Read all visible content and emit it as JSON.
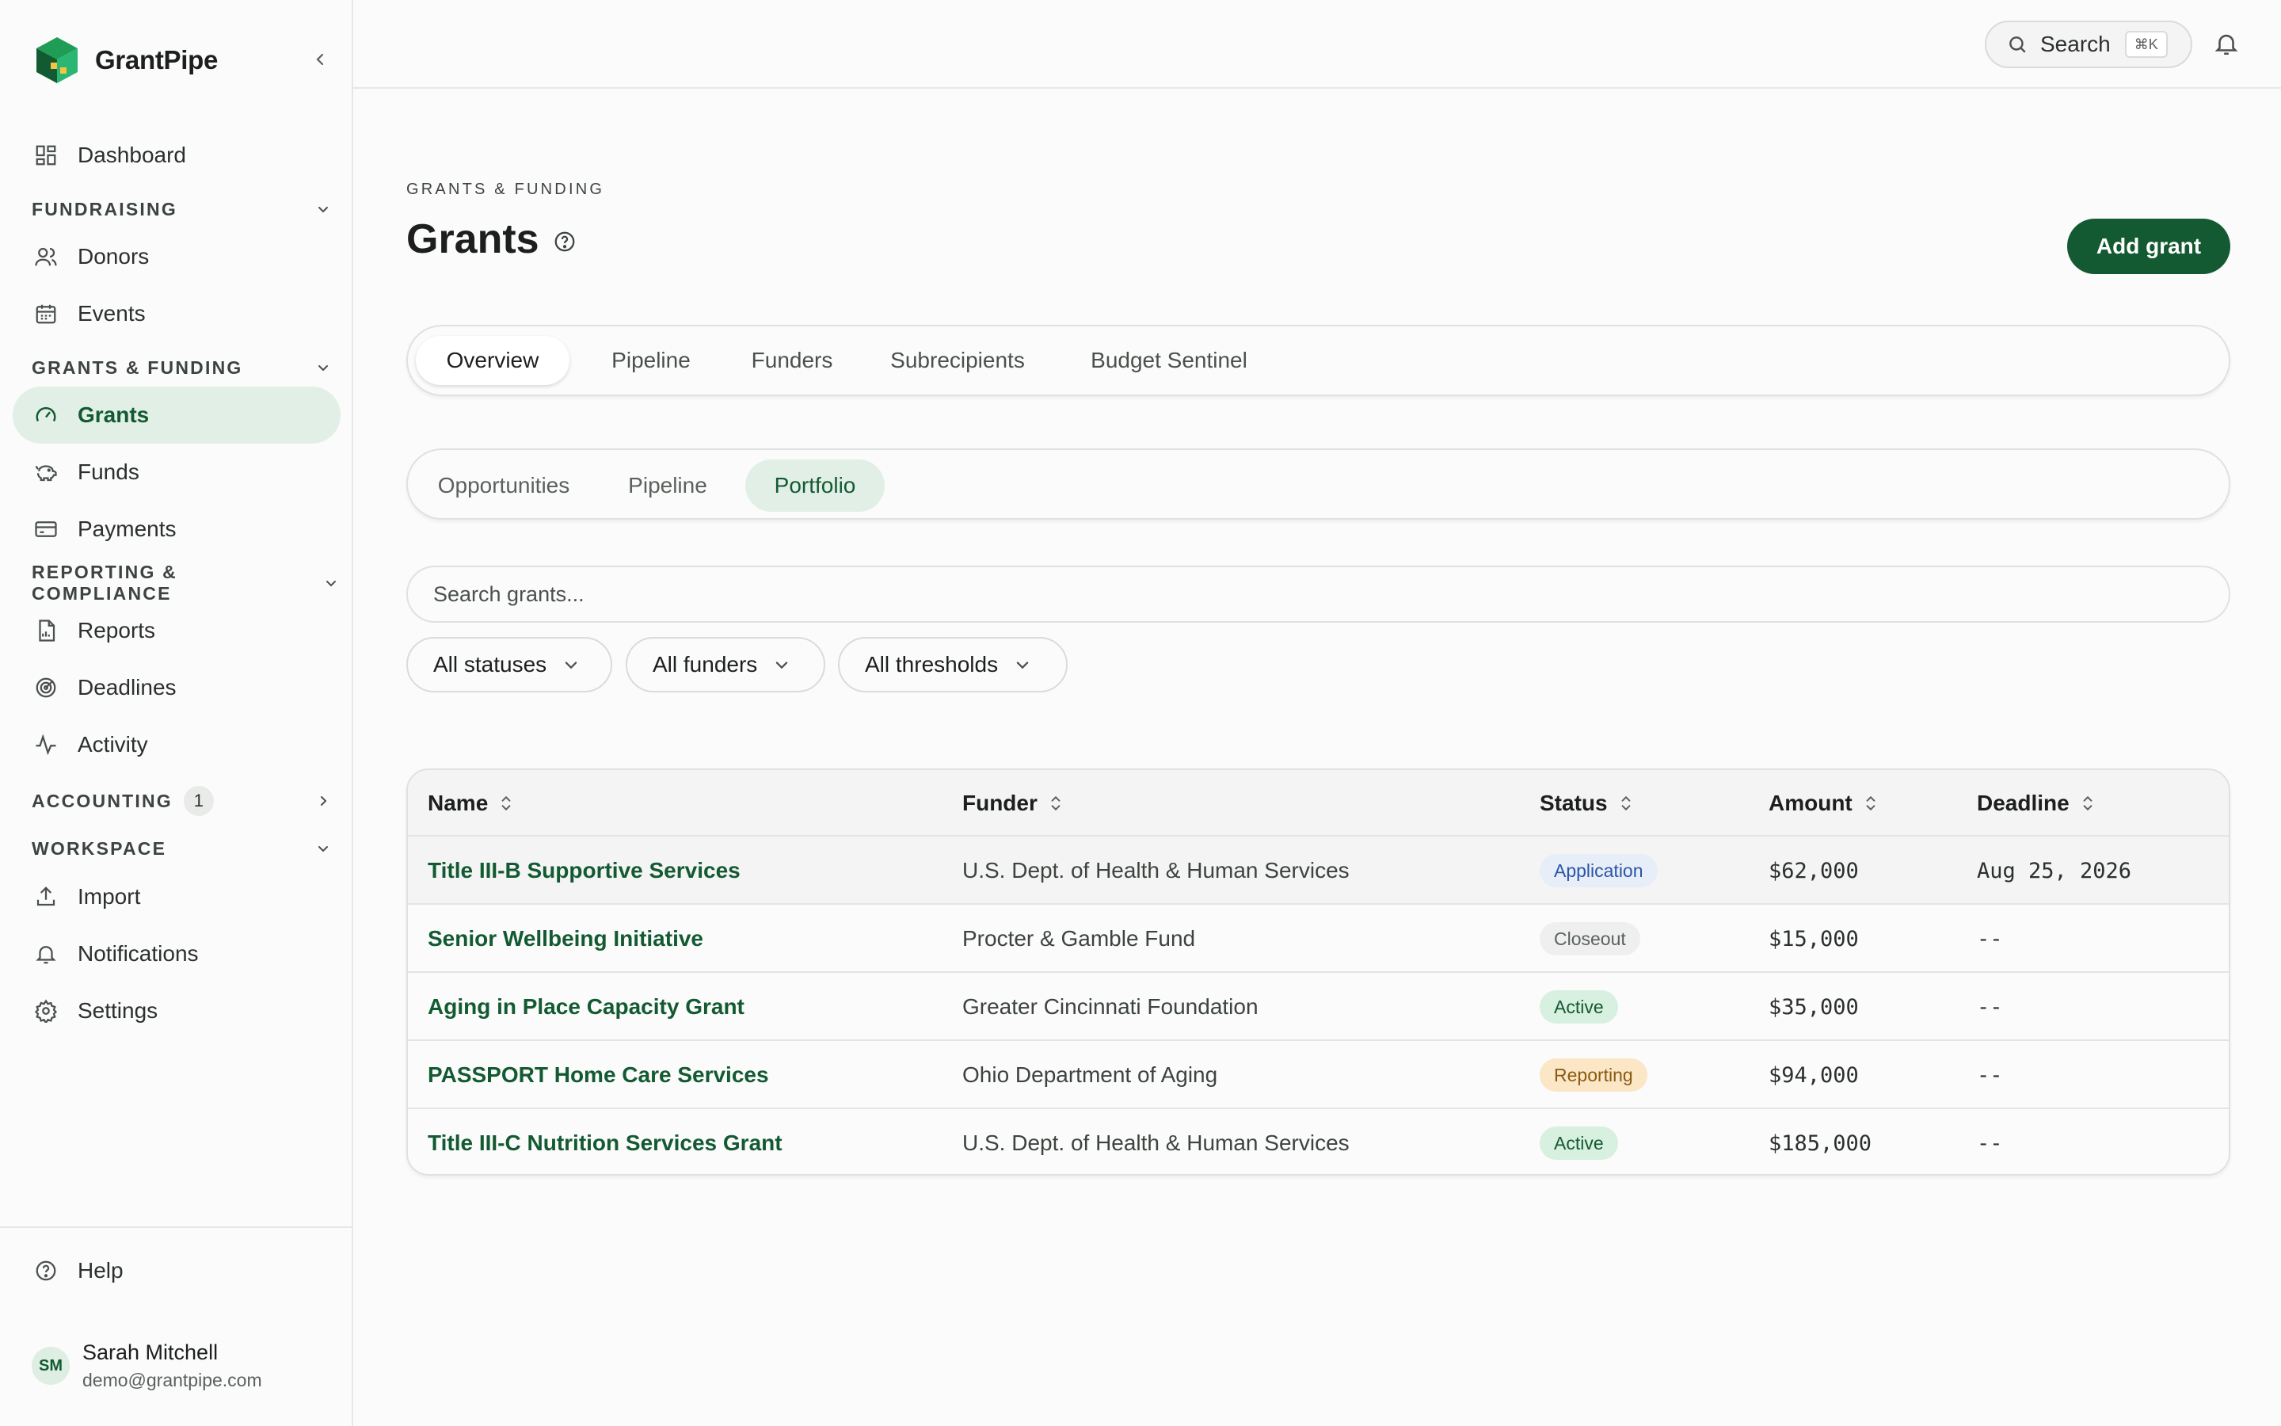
{
  "brand": {
    "name": "GrantPipe"
  },
  "sidebar": {
    "dashboard": "Dashboard",
    "sections": {
      "fundraising": "FUNDRAISING",
      "grants_funding": "GRANTS & FUNDING",
      "reporting": "REPORTING & COMPLIANCE",
      "accounting": "ACCOUNTING",
      "accounting_count": "1",
      "workspace": "WORKSPACE"
    },
    "items": {
      "donors": "Donors",
      "events": "Events",
      "grants": "Grants",
      "funds": "Funds",
      "payments": "Payments",
      "reports": "Reports",
      "deadlines": "Deadlines",
      "activity": "Activity",
      "import": "Import",
      "notifications": "Notifications",
      "settings": "Settings",
      "help": "Help"
    },
    "user": {
      "initials": "SM",
      "name": "Sarah Mitchell",
      "email": "demo@grantpipe.com"
    }
  },
  "topbar": {
    "search_label": "Search",
    "search_shortcut": "⌘K"
  },
  "header": {
    "eyebrow": "GRANTS & FUNDING",
    "title": "Grants",
    "add_button": "Add grant"
  },
  "tabs": [
    "Overview",
    "Pipeline",
    "Funders",
    "Subrecipients",
    "Budget Sentinel"
  ],
  "subtabs": [
    "Opportunities",
    "Pipeline",
    "Portfolio"
  ],
  "search": {
    "placeholder": "Search grants..."
  },
  "filters": [
    "All statuses",
    "All funders",
    "All thresholds"
  ],
  "table": {
    "columns": [
      "Name",
      "Funder",
      "Status",
      "Amount",
      "Deadline"
    ],
    "rows": [
      {
        "name": "Title III-B Supportive Services",
        "funder": "U.S. Dept. of Health & Human Services",
        "status": "Application",
        "amount": "$62,000",
        "deadline": "Aug 25, 2026"
      },
      {
        "name": "Senior Wellbeing Initiative",
        "funder": "Procter & Gamble Fund",
        "status": "Closeout",
        "amount": "$15,000",
        "deadline": "--"
      },
      {
        "name": "Aging in Place Capacity Grant",
        "funder": "Greater Cincinnati Foundation",
        "status": "Active",
        "amount": "$35,000",
        "deadline": "--"
      },
      {
        "name": "PASSPORT Home Care Services",
        "funder": "Ohio Department of Aging",
        "status": "Reporting",
        "amount": "$94,000",
        "deadline": "--"
      },
      {
        "name": "Title III-C Nutrition Services Grant",
        "funder": "U.S. Dept. of Health & Human Services",
        "status": "Active",
        "amount": "$185,000",
        "deadline": "--"
      }
    ]
  },
  "colors": {
    "primary": "#135a32",
    "active_bg": "#e2efe6"
  }
}
